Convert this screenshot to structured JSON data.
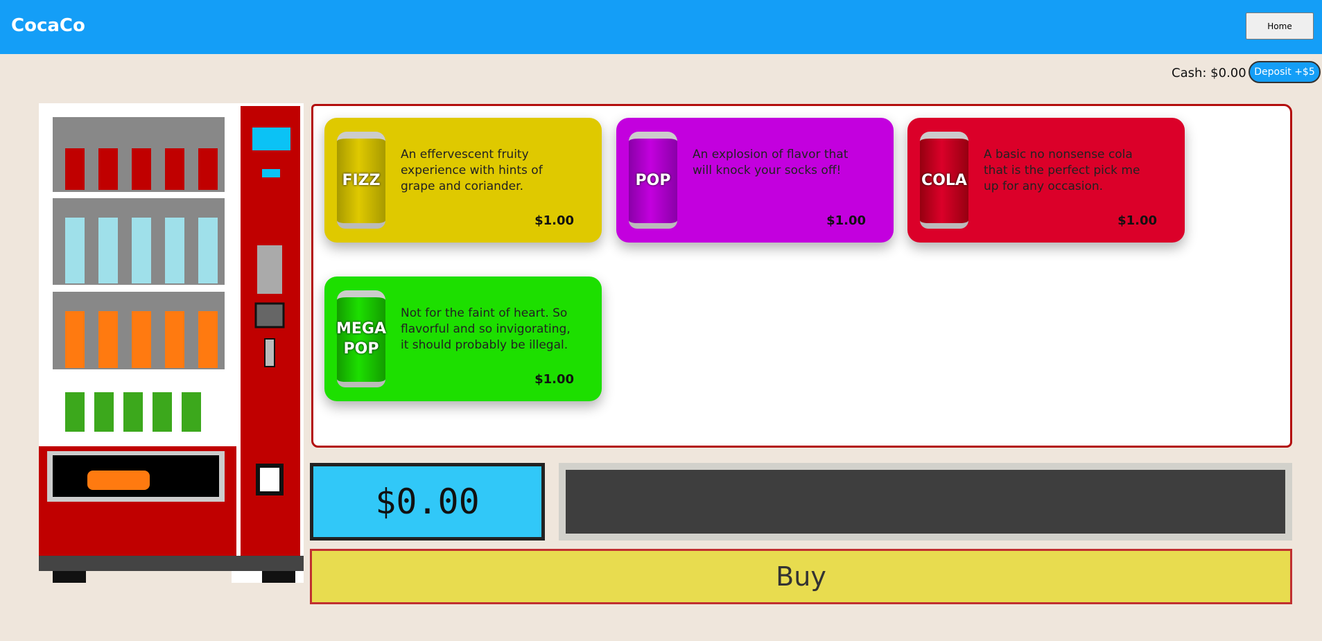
{
  "header": {
    "logo": "CocaCo",
    "home": "Home"
  },
  "wallet": {
    "cash": "Cash: $0.00",
    "deposit": "Deposit +$5"
  },
  "products": [
    {
      "label": "FIZZ",
      "desc": "An effervescent fruity experience with hints of grape and coriander.",
      "price": "$1.00",
      "color": "#dfc900",
      "can": "#a89a00"
    },
    {
      "label": "POP",
      "desc": "An explosion of flavor that will knock your socks off!",
      "price": "$1.00",
      "color": "#c300de",
      "can": "#8a00a8"
    },
    {
      "label": "COLA",
      "desc": "A basic no nonsense cola that is the perfect pick me up for any occasion.",
      "price": "$1.00",
      "color": "#db0029",
      "can": "#960010"
    },
    {
      "label": "MEGA POP",
      "desc": "Not for the faint of heart. So flavorful and so invigorating, it should probably be illegal.",
      "price": "$1.00",
      "color": "#1ddf00",
      "can": "#139c00"
    }
  ],
  "display": "$0.00",
  "buy": "Buy"
}
